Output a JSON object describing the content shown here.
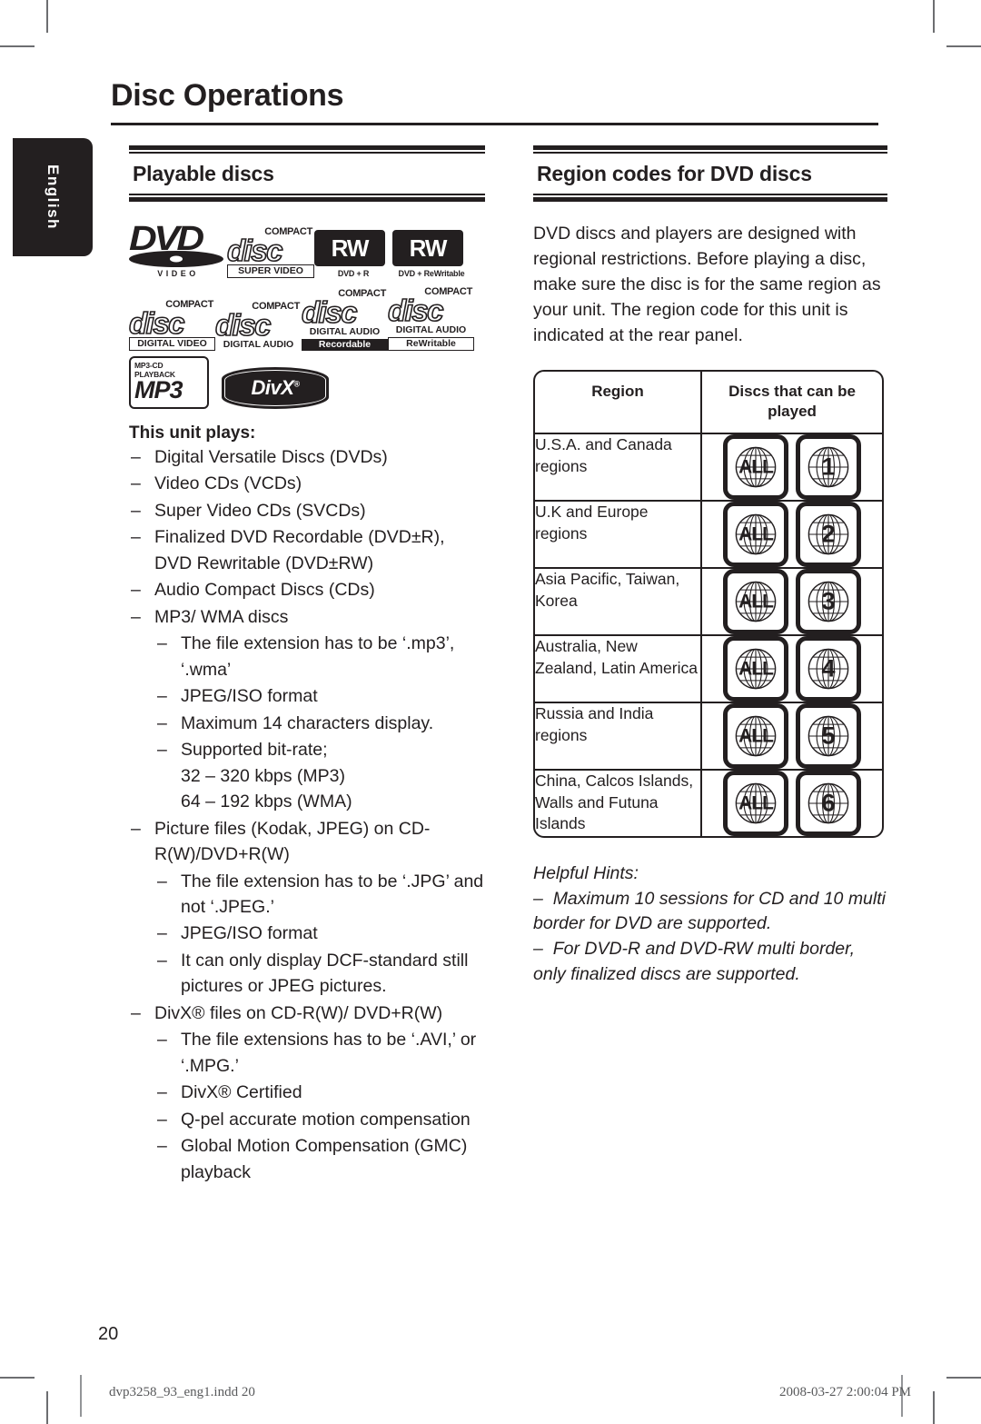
{
  "page": {
    "title": "Disc Operations",
    "language_tab": "English",
    "page_number": "20",
    "footer_file": "dvp3258_93_eng1.indd   20",
    "footer_date": "2008-03-27   2:00:04 PM"
  },
  "left_column": {
    "section_title": "Playable discs",
    "logos": [
      {
        "name": "dvd-video-logo",
        "word": "DVD",
        "sub": "VIDEO"
      },
      {
        "name": "compact-disc-super-video-logo",
        "top": "COMPACT",
        "word": "disc",
        "band": "SUPER  VIDEO"
      },
      {
        "name": "dvd-plus-r-logo",
        "word": "RW",
        "sub": "DVD + R"
      },
      {
        "name": "dvd-plus-rewritable-logo",
        "word": "RW",
        "sub": "DVD + ReWritable"
      },
      {
        "name": "compact-disc-digital-video-logo",
        "top": "COMPACT",
        "word": "disc",
        "band": "DIGITAL VIDEO"
      },
      {
        "name": "compact-disc-digital-audio-logo",
        "top": "COMPACT",
        "word": "disc",
        "band": "DIGITAL AUDIO"
      },
      {
        "name": "compact-disc-recordable-logo",
        "top": "COMPACT",
        "word": "disc",
        "band": "DIGITAL AUDIO",
        "band2": "Recordable"
      },
      {
        "name": "compact-disc-rewritable-logo",
        "top": "COMPACT",
        "word": "disc",
        "band": "DIGITAL AUDIO",
        "band2": "ReWritable"
      },
      {
        "name": "mp3-cd-playback-logo",
        "top": "MP3-CD PLAYBACK",
        "word": "MP3"
      },
      {
        "name": "divx-logo",
        "word": "DivX"
      }
    ],
    "unit_plays_title": "This unit plays:",
    "items": [
      {
        "level": 1,
        "text": "Digital Versatile Discs (DVDs)"
      },
      {
        "level": 1,
        "text": "Video CDs (VCDs)"
      },
      {
        "level": 1,
        "text": "Super Video CDs (SVCDs)"
      },
      {
        "level": 1,
        "text": "Finalized DVD Recordable (DVD±R), DVD Rewritable (DVD±RW)"
      },
      {
        "level": 1,
        "text": "Audio Compact Discs (CDs)"
      },
      {
        "level": 1,
        "text": "MP3/ WMA discs"
      },
      {
        "level": 2,
        "text": "The file extension has to be ‘.mp3’, ‘.wma’"
      },
      {
        "level": 2,
        "text": "JPEG/ISO format"
      },
      {
        "level": 2,
        "text": "Maximum 14 characters display."
      },
      {
        "level": 2,
        "text": "Supported bit-rate;",
        "cont": "32 – 320 kbps (MP3)",
        "cont2": "64 – 192 kbps (WMA)"
      },
      {
        "level": 1,
        "text": "Picture files (Kodak, JPEG) on CD-R(W)/DVD+R(W)"
      },
      {
        "level": 2,
        "text": "The file extension has to be ‘.JPG’ and not ‘.JPEG.’"
      },
      {
        "level": 2,
        "text": "JPEG/ISO format"
      },
      {
        "level": 2,
        "text": "It can only display DCF-standard still pictures or JPEG pictures."
      },
      {
        "level": 1,
        "text": "DivX® files on CD-R(W)/ DVD+R(W)"
      },
      {
        "level": 2,
        "text": "The file extensions has to be ‘.AVI,’ or ‘.MPG.’"
      },
      {
        "level": 2,
        "text": "DivX® Certified"
      },
      {
        "level": 2,
        "text": "Q-pel accurate motion compensation"
      },
      {
        "level": 2,
        "text": "Global Motion Compensation (GMC) playback"
      }
    ]
  },
  "right_column": {
    "section_title": "Region codes for DVD discs",
    "intro": "DVD discs and players are designed with regional restrictions. Before playing a disc, make sure the disc is for the same region as your unit. The region code for this unit is indicated at the rear panel.",
    "table": {
      "headers": [
        "Region",
        "Discs that can be played"
      ],
      "rows": [
        {
          "region": "U.S.A. and Canada regions",
          "badges": [
            "ALL",
            "1"
          ]
        },
        {
          "region": "U.K and Europe regions",
          "badges": [
            "ALL",
            "2"
          ]
        },
        {
          "region": "Asia Pacific, Taiwan, Korea",
          "badges": [
            "ALL",
            "3"
          ]
        },
        {
          "region": "Australia, New Zealand, Latin America",
          "badges": [
            "ALL",
            "4"
          ]
        },
        {
          "region": "Russia and India regions",
          "badges": [
            "ALL",
            "5"
          ]
        },
        {
          "region": "China, Calcos Islands, Walls and Futuna Islands",
          "badges": [
            "ALL",
            "6"
          ]
        }
      ]
    },
    "hints": {
      "title": "Helpful Hints:",
      "items": [
        "Maximum 10 sessions for CD and 10 multi border for DVD are supported.",
        "For DVD-R and DVD-RW multi border, only finalized discs are supported."
      ]
    }
  },
  "colors": {
    "ink": "#231f20",
    "rule": "#6d6e71",
    "footer_text": "#58595b"
  }
}
